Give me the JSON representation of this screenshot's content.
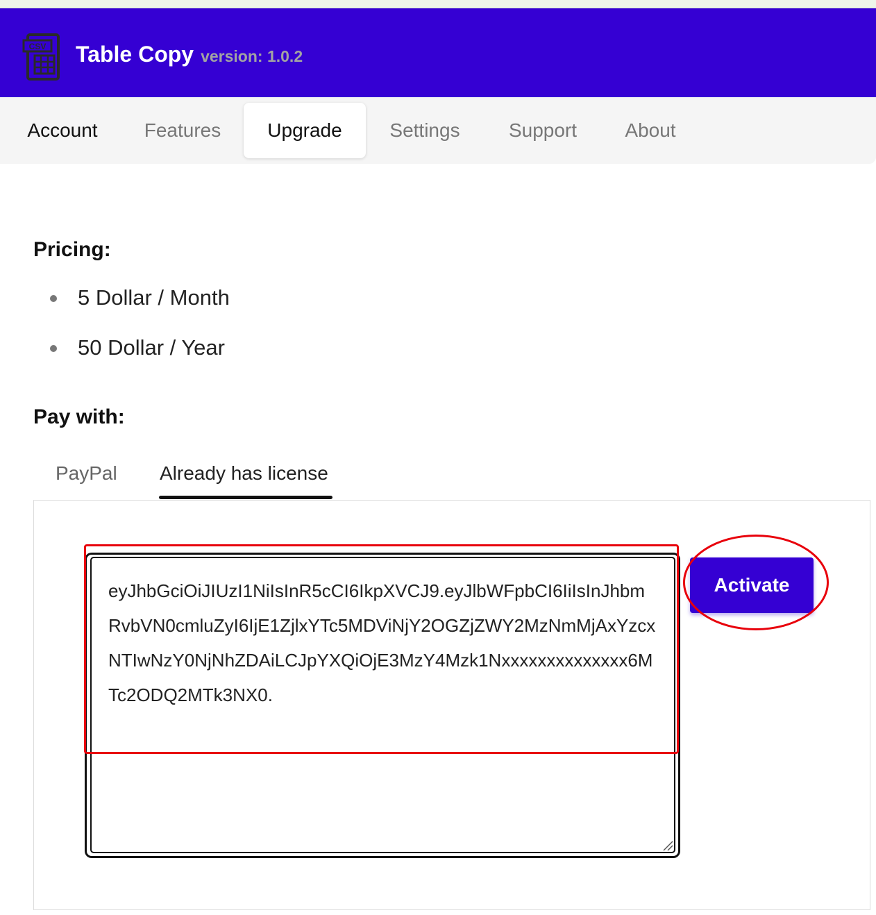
{
  "header": {
    "app_title": "Table Copy",
    "version_label": "version: 1.0.2",
    "logo_icon": "csv-table-icon",
    "background_color": "#3500d3"
  },
  "nav": {
    "tabs": [
      {
        "label": "Account"
      },
      {
        "label": "Features"
      },
      {
        "label": "Upgrade",
        "selected": true
      },
      {
        "label": "Settings"
      },
      {
        "label": "Support"
      },
      {
        "label": "About"
      }
    ]
  },
  "pricing": {
    "heading": "Pricing:",
    "items": [
      "5 Dollar / Month",
      "50 Dollar / Year"
    ]
  },
  "pay_with": {
    "heading": "Pay with:",
    "tabs": [
      {
        "label": "PayPal"
      },
      {
        "label": "Already has license",
        "active": true
      }
    ]
  },
  "license": {
    "value": "eyJhbGciOiJIUzI1NiIsInR5cCI6IkpXVCJ9.eyJlbWFpbCI6IiIsInJhbmRvbVN0cmluZyI6IjE1ZjlxYTc5MDViNjY2OGZjZWY2MzNmMjAxYzcxNTIwNzY0NjNhZDAiLCJpYXQiOjE3MzY4Mzk1Nxxxxxxxxxxxxxx6MTc2ODQ2MTk3NX0.",
    "activate_label": "Activate",
    "annotation_color": "#e8000b"
  }
}
